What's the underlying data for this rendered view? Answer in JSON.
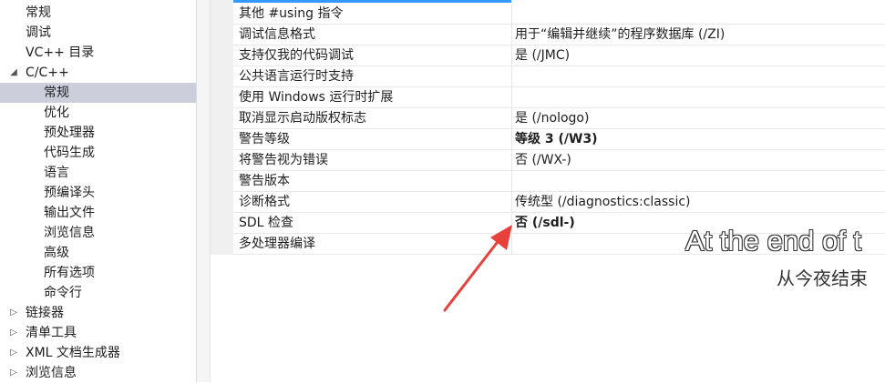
{
  "tree": {
    "items": [
      {
        "label": "常规",
        "level": 1
      },
      {
        "label": "调试",
        "level": 1
      },
      {
        "label": "VC++ 目录",
        "level": 1
      },
      {
        "label": "C/C++",
        "level": 0,
        "expander": "▲"
      },
      {
        "label": "常规",
        "level": 2,
        "selected": true
      },
      {
        "label": "优化",
        "level": 2
      },
      {
        "label": "预处理器",
        "level": 2
      },
      {
        "label": "代码生成",
        "level": 2
      },
      {
        "label": "语言",
        "level": 2
      },
      {
        "label": "预编译头",
        "level": 2
      },
      {
        "label": "输出文件",
        "level": 2
      },
      {
        "label": "浏览信息",
        "level": 2
      },
      {
        "label": "高级",
        "level": 2
      },
      {
        "label": "所有选项",
        "level": 2
      },
      {
        "label": "命令行",
        "level": 2
      },
      {
        "label": "链接器",
        "level": 0,
        "expander": "▷"
      },
      {
        "label": "清单工具",
        "level": 0,
        "expander": "▷"
      },
      {
        "label": "XML 文档生成器",
        "level": 0,
        "expander": "▷"
      },
      {
        "label": "浏览信息",
        "level": 0,
        "expander": "▷"
      }
    ]
  },
  "properties": [
    {
      "name": "其他 #using 指令",
      "value": "",
      "bold": false
    },
    {
      "name": "调试信息格式",
      "value": "用于“编辑并继续”的程序数据库 (/ZI)",
      "bold": false
    },
    {
      "name": "支持仅我的代码调试",
      "value": "是 (/JMC)",
      "bold": false
    },
    {
      "name": "公共语言运行时支持",
      "value": "",
      "bold": false
    },
    {
      "name": "使用 Windows 运行时扩展",
      "value": "",
      "bold": false
    },
    {
      "name": "取消显示启动版权标志",
      "value": "是 (/nologo)",
      "bold": false
    },
    {
      "name": "警告等级",
      "value": "等级 3 (/W3)",
      "bold": true
    },
    {
      "name": "将警告视为错误",
      "value": "否 (/WX-)",
      "bold": false
    },
    {
      "name": "警告版本",
      "value": "",
      "bold": false
    },
    {
      "name": "诊断格式",
      "value": "传统型 (/diagnostics:classic)",
      "bold": false
    },
    {
      "name": "SDL 检查",
      "value": "否 (/sdl-)",
      "bold": true
    },
    {
      "name": "多处理器编译",
      "value": "",
      "bold": false
    }
  ],
  "subtitle": {
    "en": "At the end of t",
    "zh": "从今夜结束"
  },
  "colors": {
    "selection": "#cccedb",
    "accent": "#3399ff",
    "annotation_arrow": "#e8413c"
  },
  "icons": {
    "expanded": "triangle-down-icon",
    "collapsed": "triangle-right-icon",
    "annotation": "red-arrow-icon"
  }
}
